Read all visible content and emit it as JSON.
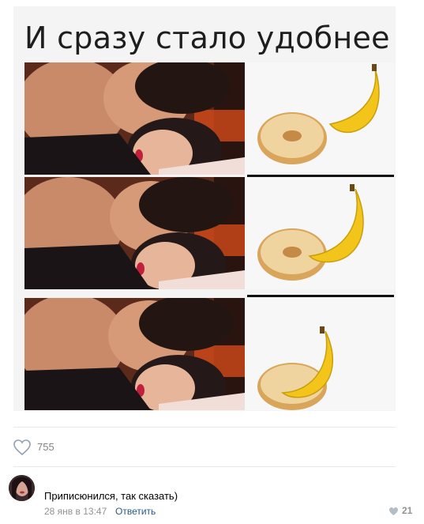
{
  "post": {
    "meme_title": "И сразу стало удобнее",
    "likes": "755"
  },
  "comment": {
    "text": "Приписюнился, так сказать)",
    "date": "28 янв в 13:47",
    "reply": "Ответить",
    "likes": "21"
  },
  "colors": {
    "link": "#2a5885",
    "muted": "#939393",
    "separator": "#e7e8ec"
  },
  "icons": {
    "like": "heart-outline-icon",
    "comment_like": "heart-filled-icon"
  }
}
